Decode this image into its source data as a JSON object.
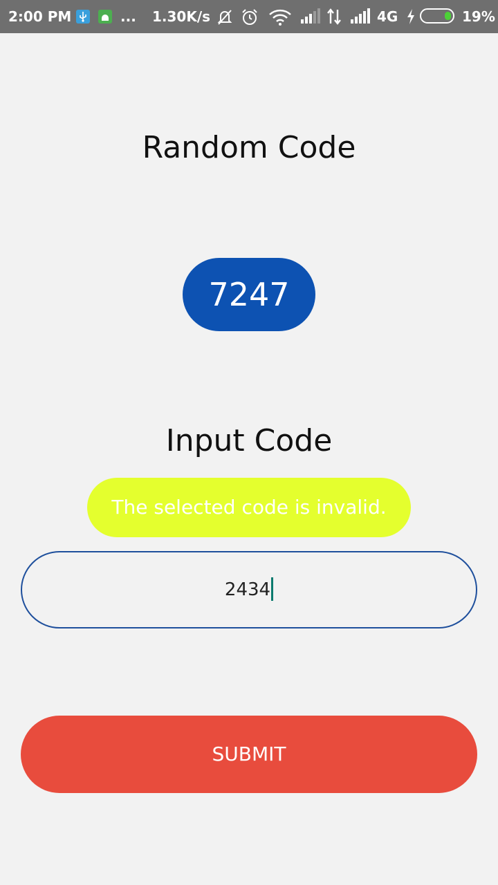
{
  "status_bar": {
    "time": "2:00 PM",
    "overflow_dots": "...",
    "net_speed": "1.30K/s",
    "network_type": "4G",
    "battery_percent": "19%",
    "icons": [
      "usb-icon",
      "android-debug-icon",
      "mute-bell-icon",
      "alarm-icon",
      "wifi-icon",
      "signal-icon",
      "data-arrows-icon",
      "signal-icon",
      "charging-icon",
      "battery-icon"
    ],
    "battery_color": "#4cd137"
  },
  "random": {
    "title": "Random Code",
    "code": "7247",
    "pill_color": "#0d52b2"
  },
  "input": {
    "title": "Input Code",
    "error_message": "The selected code is invalid.",
    "error_color": "#e4ff2e",
    "value": "2434",
    "border_color": "#1e4f9c"
  },
  "submit": {
    "label": "SUBMIT",
    "color": "#e84c3d"
  }
}
